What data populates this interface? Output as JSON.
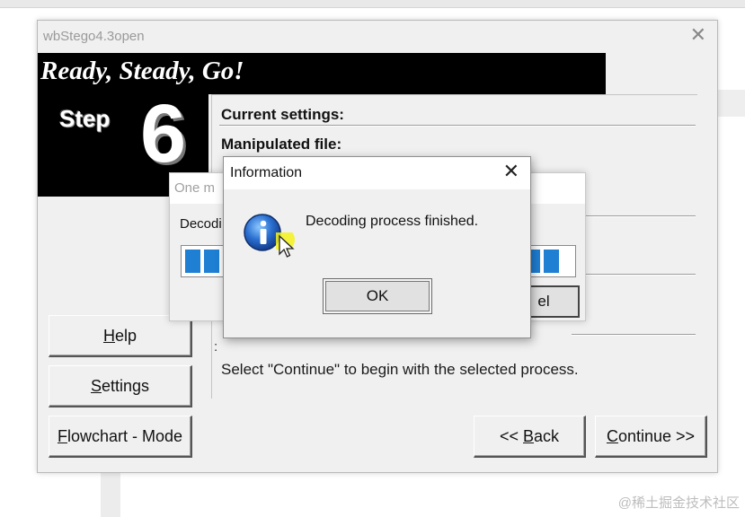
{
  "window": {
    "title": "wbStego4.3open",
    "banner": "Ready, Steady, Go!",
    "step_word": "Step",
    "step_number": "6"
  },
  "panel": {
    "current_settings": "Current settings:",
    "manipulated_file": "Manipulated file:",
    "info_text": "Select \"Continue\" to begin with the selected process."
  },
  "left_buttons": {
    "help": {
      "pre": "",
      "ul": "H",
      "post": "elp"
    },
    "settings": {
      "pre": "",
      "ul": "S",
      "post": "ettings"
    },
    "flowchart": {
      "pre": "",
      "ul": "F",
      "post": "lowchart - Mode"
    }
  },
  "nav": {
    "back": {
      "pre": "<< ",
      "ul": "B",
      "post": "ack"
    },
    "continue": {
      "pre": "",
      "ul": "C",
      "post": "ontinue >>"
    }
  },
  "progress_dialog": {
    "title_fragment": "One m",
    "label_fragment": "Decodi",
    "cancel_fragment": "el",
    "progress": 1.0
  },
  "info_dialog": {
    "title": "Information",
    "message": "Decoding process finished.",
    "ok": "OK",
    "icon": "information-icon"
  },
  "watermark": "@稀土掘金技术社区",
  "colors": {
    "progress_fill": "#1e7fd3",
    "banner_bg": "#000000",
    "dialog_bg": "#f0f0f0"
  }
}
